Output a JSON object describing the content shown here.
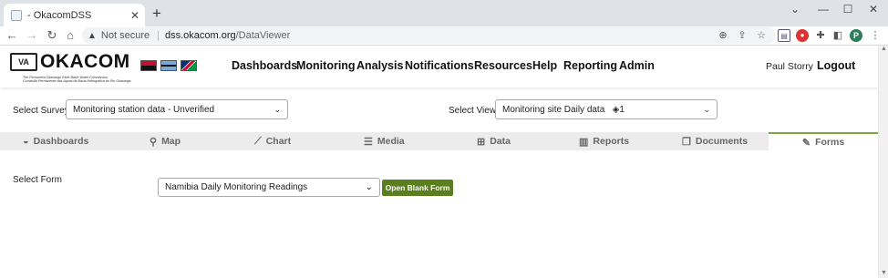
{
  "browser": {
    "tab_title": "- OkacomDSS",
    "tab_close": "✕",
    "new_tab": "+",
    "not_secure": "Not secure",
    "url_host": "dss.okacom.org",
    "url_path": "/DataViewer",
    "profile_initial": "P"
  },
  "header": {
    "logo_mark": "VA",
    "logo_text": "OKACOM",
    "logo_sub1": "The Permanent Okavango River Basin Water Commission",
    "logo_sub2": "Comissão Permanente das Águas da Bacia Hidrográfica do Rio Okavango",
    "menu": [
      "Dashboards",
      "Monitoring",
      "Analysis",
      "Notifications",
      "Resources",
      "Help",
      "Reporting",
      "Admin"
    ],
    "user": "Paul Storry",
    "logout": "Logout"
  },
  "filters": {
    "survey_label": "Select Survey:",
    "survey_value": "Monitoring station data - Unverified",
    "view_label": "Select View:",
    "view_value": "Monitoring site Daily data",
    "view_badge": "1"
  },
  "tabs": [
    {
      "label": "Dashboards",
      "icon": "tachometer-icon"
    },
    {
      "label": "Map",
      "icon": "map-marker-icon"
    },
    {
      "label": "Chart",
      "icon": "line-chart-icon"
    },
    {
      "label": "Media",
      "icon": "list-icon"
    },
    {
      "label": "Data",
      "icon": "table-icon"
    },
    {
      "label": "Reports",
      "icon": "bar-chart-icon"
    },
    {
      "label": "Documents",
      "icon": "documents-icon"
    },
    {
      "label": "Forms",
      "icon": "edit-icon"
    }
  ],
  "active_tab": "Forms",
  "form": {
    "label": "Select Form",
    "value": "Namibia Daily Monitoring Readings",
    "button": "Open Blank Form"
  },
  "colors": {
    "accent_green": "#5b7f1f",
    "active_tab_border": "#7aa83c"
  }
}
